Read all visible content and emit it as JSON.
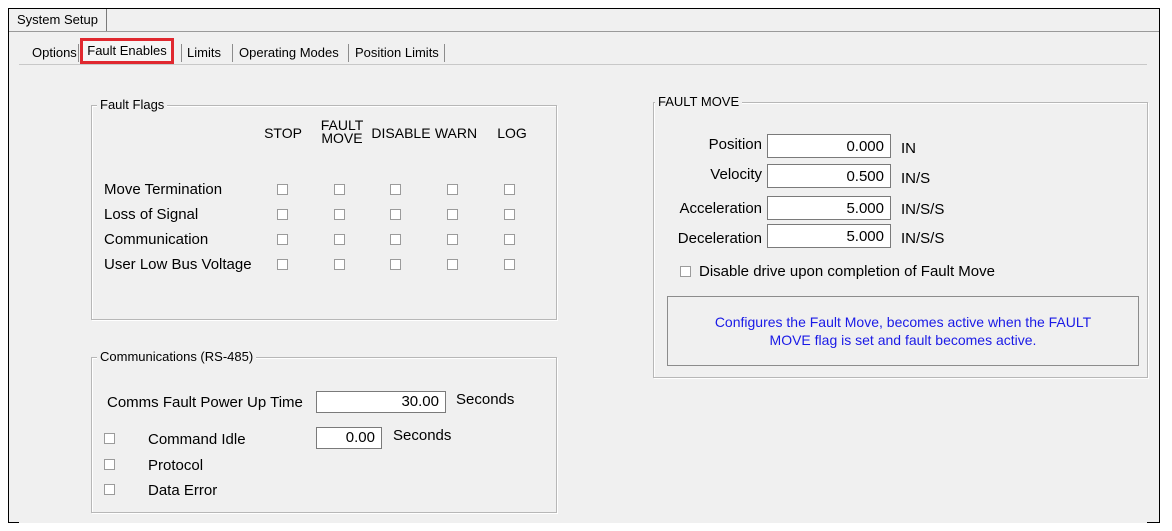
{
  "window": {
    "outer_tab": "System Setup"
  },
  "tabs": [
    "Options",
    "Fault Enables",
    "Limits",
    "Operating Modes",
    "Position Limits"
  ],
  "active_tab": "Fault Enables",
  "fault_flags": {
    "title": "Fault Flags",
    "columns": [
      "STOP",
      "FAULT MOVE",
      "DISABLE",
      "WARN",
      "LOG"
    ],
    "column_fault_move_lines": [
      "FAULT",
      "MOVE"
    ],
    "rows": [
      "Move Termination",
      "Loss of Signal",
      "Communication",
      "User Low Bus Voltage"
    ]
  },
  "communications": {
    "title": "Communications (RS-485)",
    "power_up_label": "Comms Fault Power Up Time",
    "power_up_value": "30.00",
    "power_up_unit": "Seconds",
    "command_idle_label": "Command Idle",
    "command_idle_value": "0.00",
    "command_idle_unit": "Seconds",
    "protocol_label": "Protocol",
    "data_error_label": "Data Error"
  },
  "fault_move": {
    "title": "FAULT MOVE",
    "fields": [
      {
        "label": "Position",
        "value": "0.000",
        "unit": "IN"
      },
      {
        "label": "Velocity",
        "value": "0.500",
        "unit": "IN/S"
      },
      {
        "label": "Acceleration",
        "value": "5.000",
        "unit": "IN/S/S"
      },
      {
        "label": "Deceleration",
        "value": "5.000",
        "unit": "IN/S/S"
      }
    ],
    "disable_checkbox_label": "Disable drive upon completion of Fault Move",
    "note_line1": "Configures the Fault Move,  becomes active when the FAULT",
    "note_line2": "MOVE flag is set and fault becomes active."
  },
  "colors": {
    "highlight": "#e0282f",
    "note_text": "#1a1ae6"
  }
}
